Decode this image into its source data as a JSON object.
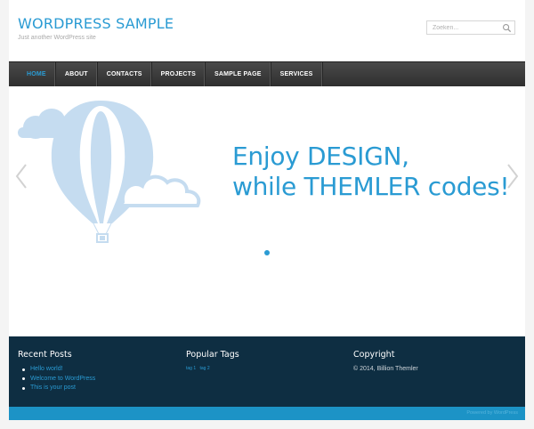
{
  "header": {
    "title": "WORDPRESS SAMPLE",
    "tagline": "Just another WordPress site",
    "search_placeholder": "Zoeken..."
  },
  "nav": {
    "items": [
      {
        "label": "HOME",
        "active": true
      },
      {
        "label": "ABOUT"
      },
      {
        "label": "CONTACTS"
      },
      {
        "label": "PROJECTS"
      },
      {
        "label": "SAMPLE PAGE"
      },
      {
        "label": "SERVICES"
      }
    ]
  },
  "slider": {
    "line1": "Enjoy DESIGN,",
    "line2": "while THEMLER codes!",
    "colors": {
      "accent": "#2a9bd3",
      "balloon": "#c5dcf0",
      "arrow": "#d2d2d2"
    }
  },
  "footer": {
    "recent_posts": {
      "title": "Recent Posts",
      "items": [
        "Hello world!",
        "Welcome to WordPress",
        "This is your post"
      ]
    },
    "popular_tags": {
      "title": "Popular Tags",
      "tags": [
        "tag 1",
        "tag 2"
      ]
    },
    "copyright": {
      "title": "Copyright",
      "text": "© 2014, Billion Themler"
    },
    "powered": "Powered by WordPress",
    "colors": {
      "background": "#0e2e42",
      "bar": "#1c93c6"
    }
  }
}
